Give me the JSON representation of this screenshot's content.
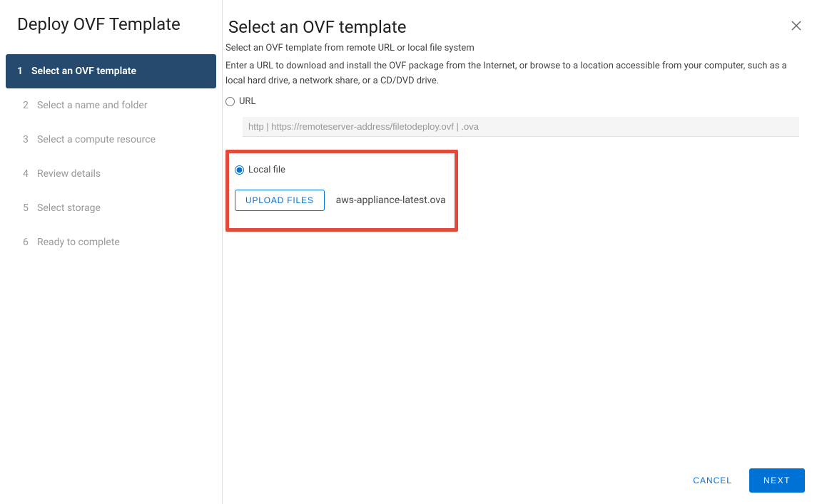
{
  "wizard": {
    "title": "Deploy OVF Template",
    "steps": [
      {
        "number": "1",
        "label": "Select an OVF template",
        "active": true
      },
      {
        "number": "2",
        "label": "Select a name and folder",
        "active": false
      },
      {
        "number": "3",
        "label": "Select a compute resource",
        "active": false
      },
      {
        "number": "4",
        "label": "Review details",
        "active": false
      },
      {
        "number": "5",
        "label": "Select storage",
        "active": false
      },
      {
        "number": "6",
        "label": "Ready to complete",
        "active": false
      }
    ]
  },
  "main": {
    "title": "Select an OVF template",
    "subtitle": "Select an OVF template from remote URL or local file system",
    "description": "Enter a URL to download and install the OVF package from the Internet, or browse to a location accessible from your computer, such as a local hard drive, a network share, or a CD/DVD drive.",
    "url_label": "URL",
    "url_placeholder": "http | https://remoteserver-address/filetodeploy.ovf | .ova",
    "local_file_label": "Local file",
    "upload_label": "UPLOAD FILES",
    "filename": "aws-appliance-latest.ova"
  },
  "footer": {
    "cancel": "CANCEL",
    "next": "NEXT"
  }
}
